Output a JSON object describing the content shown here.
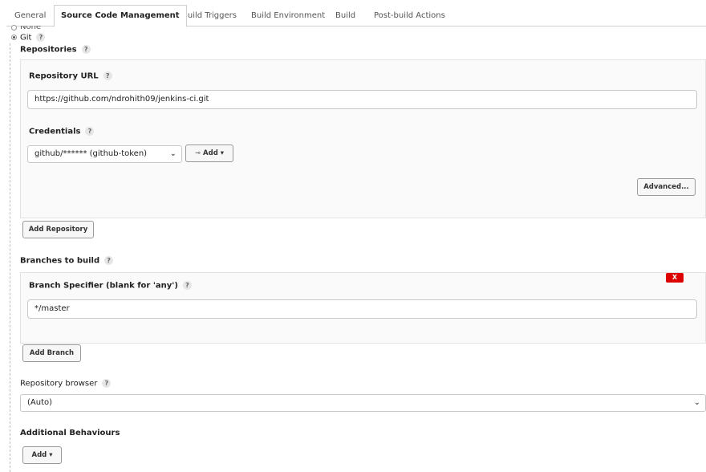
{
  "tabs": [
    {
      "label": "General"
    },
    {
      "label": "Source Code Management"
    },
    {
      "label": "Build Triggers"
    },
    {
      "label": "Build Environment"
    },
    {
      "label": "Build"
    },
    {
      "label": "Post-build Actions"
    }
  ],
  "scm": {
    "none_label": "None",
    "git_label": "Git",
    "help": "?",
    "repositories": {
      "title": "Repositories",
      "url_label": "Repository URL",
      "url_value": "https://github.com/ndrohith09/jenkins-ci.git",
      "credentials_label": "Credentials",
      "credentials_value": "github/****** (github-token)",
      "add_button": "Add",
      "advanced_button": "Advanced...",
      "add_repository_button": "Add Repository"
    },
    "branches": {
      "title": "Branches to build",
      "specifier_label": "Branch Specifier (blank for 'any')",
      "specifier_value": "*/master",
      "delete_button": "X",
      "add_branch_button": "Add Branch"
    },
    "repo_browser": {
      "label": "Repository browser",
      "value": "(Auto)"
    },
    "additional": {
      "title": "Additional Behaviours",
      "add_button": "Add"
    }
  },
  "colors": {
    "delete": "#dd0000",
    "border": "#c8c8c8"
  }
}
